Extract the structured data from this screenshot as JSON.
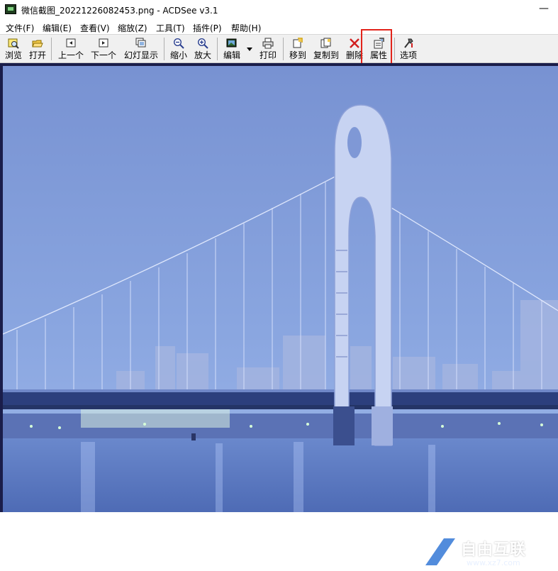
{
  "window": {
    "title": "微信截图_20221226082453.png - ACDSee v3.1",
    "minimize_glyph": "—",
    "app_icon": "acdsee-app-icon"
  },
  "menu": [
    {
      "label": "文件(F)"
    },
    {
      "label": "编辑(E)"
    },
    {
      "label": "查看(V)"
    },
    {
      "label": "缩放(Z)"
    },
    {
      "label": "工具(T)"
    },
    {
      "label": "插件(P)"
    },
    {
      "label": "帮助(H)"
    }
  ],
  "toolbar": {
    "buttons": [
      {
        "label": "浏览",
        "icon": "browse-icon"
      },
      {
        "label": "打开",
        "icon": "open-folder-icon"
      },
      {
        "label": "上一个",
        "icon": "previous-icon"
      },
      {
        "label": "下一个",
        "icon": "next-icon"
      },
      {
        "label": "幻灯显示",
        "icon": "slideshow-icon"
      },
      {
        "label": "缩小",
        "icon": "zoom-out-icon"
      },
      {
        "label": "放大",
        "icon": "zoom-in-icon"
      },
      {
        "label": "编辑",
        "icon": "edit-icon"
      },
      {
        "label": "打印",
        "icon": "print-icon"
      },
      {
        "label": "移到",
        "icon": "move-to-icon"
      },
      {
        "label": "复制到",
        "icon": "copy-to-icon"
      },
      {
        "label": "删除",
        "icon": "delete-icon"
      },
      {
        "label": "属性",
        "icon": "properties-icon"
      },
      {
        "label": "选项",
        "icon": "options-icon"
      }
    ],
    "highlight_color": "#e2231a"
  },
  "watermark": {
    "text": "自由互联",
    "url": "www.xz7.com"
  },
  "colors": {
    "sky": "#7f9bd6",
    "water": "#4f6fb8",
    "viewer_border": "#1a1d4a"
  }
}
